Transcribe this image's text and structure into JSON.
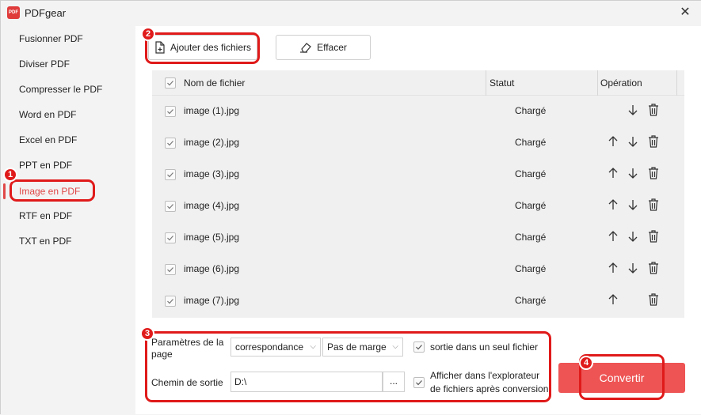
{
  "app": {
    "title": "PDFgear",
    "logo_text": "PDF"
  },
  "sidebar": {
    "items": [
      {
        "label": "Fusionner PDF"
      },
      {
        "label": "Diviser PDF"
      },
      {
        "label": "Compresser le PDF"
      },
      {
        "label": "Word en PDF"
      },
      {
        "label": "Excel en PDF"
      },
      {
        "label": "PPT en PDF"
      },
      {
        "label": "Image en PDF",
        "active": true
      },
      {
        "label": "RTF en PDF"
      },
      {
        "label": "TXT en PDF"
      }
    ]
  },
  "toolbar": {
    "add_label": "Ajouter des fichiers",
    "clear_label": "Effacer"
  },
  "table": {
    "columns": {
      "name": "Nom de fichier",
      "status": "Statut",
      "operation": "Opération"
    },
    "rows": [
      {
        "name": "image (1).jpg",
        "status": "Chargé",
        "up": false,
        "down": true
      },
      {
        "name": "image (2).jpg",
        "status": "Chargé",
        "up": true,
        "down": true
      },
      {
        "name": "image (3).jpg",
        "status": "Chargé",
        "up": true,
        "down": true
      },
      {
        "name": "image (4).jpg",
        "status": "Chargé",
        "up": true,
        "down": true
      },
      {
        "name": "image (5).jpg",
        "status": "Chargé",
        "up": true,
        "down": true
      },
      {
        "name": "image (6).jpg",
        "status": "Chargé",
        "up": true,
        "down": true
      },
      {
        "name": "image (7).jpg",
        "status": "Chargé",
        "up": true,
        "down": false
      }
    ]
  },
  "settings": {
    "page_label": "Paramètres de la page",
    "page_label_line1": "Paramètres de la",
    "page_label_line2": "page",
    "fit_value": "correspondance",
    "margin_value": "Pas de marge",
    "single_file_label": "sortie dans un seul fichier",
    "output_label": "Chemin de sortie",
    "output_path": "D:\\",
    "browse_label": "...",
    "open_explorer_line1": "Afficher dans l'explorateur",
    "open_explorer_line2": "de fichiers après conversion"
  },
  "convert_label": "Convertir",
  "annotations": [
    "1",
    "2",
    "3",
    "4"
  ],
  "colors": {
    "accent": "#ee5454",
    "highlight": "#e01a1a",
    "active_text": "#e04848"
  }
}
